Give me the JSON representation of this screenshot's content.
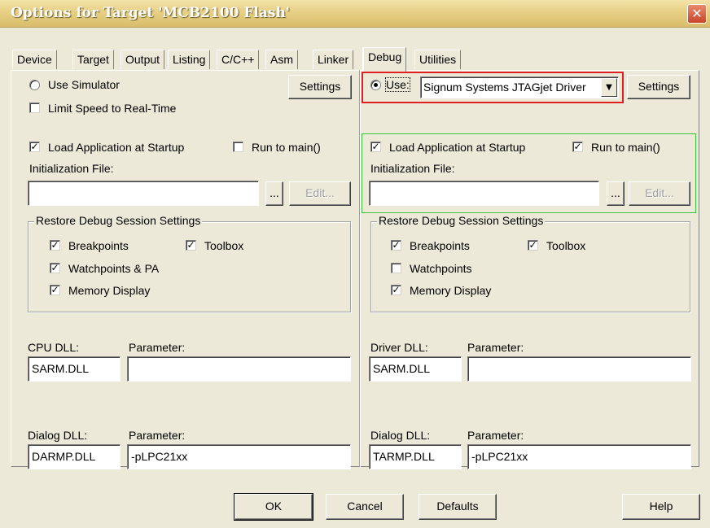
{
  "window": {
    "title": "Options for Target 'MCB2100 Flash'",
    "close_glyph": "✕"
  },
  "tabs": [
    "Device",
    "Target",
    "Output",
    "Listing",
    "C/C++",
    "Asm",
    "Linker",
    "Debug",
    "Utilities"
  ],
  "active_tab": "Debug",
  "left": {
    "use_simulator_label": "Use Simulator",
    "use_simulator_selected": false,
    "limit_speed_label": "Limit Speed to Real-Time",
    "limit_speed_checked": false,
    "settings_button": "Settings",
    "load_app_label": "Load Application at Startup",
    "load_app_checked": true,
    "run_to_main_label": "Run to main()",
    "run_to_main_checked": false,
    "init_file_label": "Initialization File:",
    "init_file_value": "",
    "browse_button": "...",
    "edit_button": "Edit...",
    "restore_group_title": "Restore Debug Session Settings",
    "restore": {
      "breakpoints": {
        "label": "Breakpoints",
        "checked": true
      },
      "toolbox": {
        "label": "Toolbox",
        "checked": true
      },
      "watchpoints": {
        "label": "Watchpoints & PA",
        "checked": true
      },
      "memory": {
        "label": "Memory Display",
        "checked": true
      }
    },
    "cpu_dll_label": "CPU DLL:",
    "cpu_dll_value": "SARM.DLL",
    "cpu_param_label": "Parameter:",
    "cpu_param_value": "",
    "dialog_dll_label": "Dialog DLL:",
    "dialog_dll_value": "DARMP.DLL",
    "dialog_param_label": "Parameter:",
    "dialog_param_value": "-pLPC21xx"
  },
  "right": {
    "use_label": "Use:",
    "use_selected": true,
    "driver_select": "Signum Systems JTAGjet Driver",
    "settings_button": "Settings",
    "load_app_label": "Load Application at Startup",
    "load_app_checked": true,
    "run_to_main_label": "Run to main()",
    "run_to_main_checked": true,
    "init_file_label": "Initialization File:",
    "init_file_value": "",
    "browse_button": "...",
    "edit_button": "Edit...",
    "restore_group_title": "Restore Debug Session Settings",
    "restore": {
      "breakpoints": {
        "label": "Breakpoints",
        "checked": true
      },
      "toolbox": {
        "label": "Toolbox",
        "checked": true
      },
      "watchpoints": {
        "label": "Watchpoints",
        "checked": false
      },
      "memory": {
        "label": "Memory Display",
        "checked": true
      }
    },
    "driver_dll_label": "Driver DLL:",
    "driver_dll_value": "SARM.DLL",
    "driver_param_label": "Parameter:",
    "driver_param_value": "",
    "dialog_dll_label": "Dialog DLL:",
    "dialog_dll_value": "TARMP.DLL",
    "dialog_param_label": "Parameter:",
    "dialog_param_value": "-pLPC21xx"
  },
  "footer": {
    "ok": "OK",
    "cancel": "Cancel",
    "defaults": "Defaults",
    "help": "Help"
  },
  "colors": {
    "highlight_red": "#e02020",
    "highlight_green": "#3cc43c",
    "dialog_bg": "#ece9d8"
  }
}
